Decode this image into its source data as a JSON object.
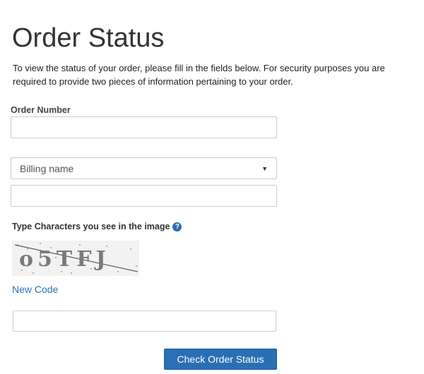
{
  "page": {
    "title": "Order Status",
    "intro": "To view the status of your order, please fill in the fields below. For security purposes you are required to provide two pieces of information pertaining to your order."
  },
  "form": {
    "order_number_label": "Order Number",
    "order_number_value": "",
    "identifier_select": {
      "selected": "Billing name",
      "caret_icon": "triangle-down-icon"
    },
    "identifier_value": "",
    "captcha": {
      "label": "Type Characters you see in the image",
      "help_icon": "question-circle-icon",
      "help_glyph": "?",
      "image_text": "o5TFJ",
      "new_code_label": "New Code",
      "value": ""
    },
    "submit_label": "Check Order Status"
  },
  "colors": {
    "link": "#2a6fb4",
    "button": "#2a6fb4",
    "border": "#cccccc"
  }
}
